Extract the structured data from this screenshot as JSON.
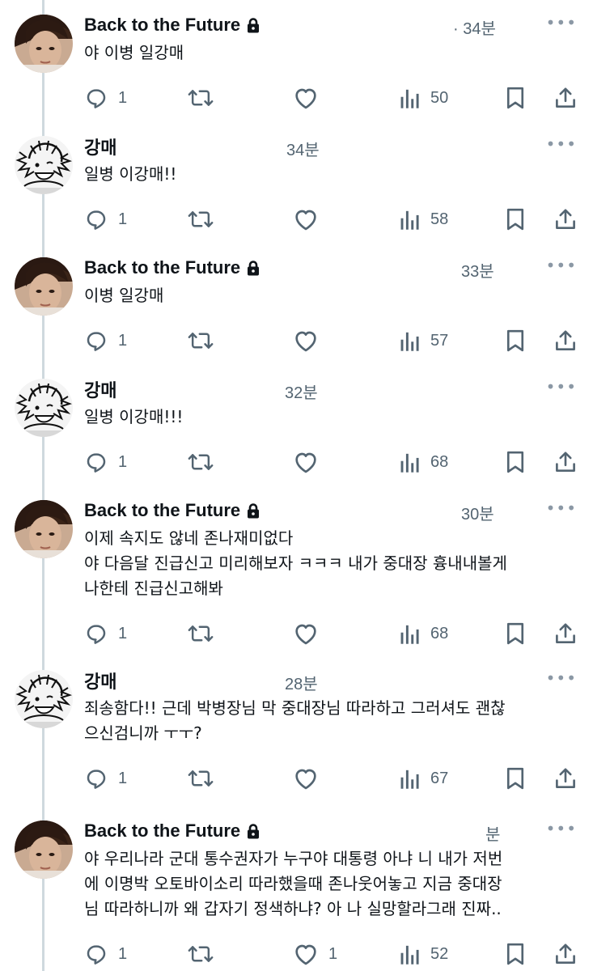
{
  "colors": {
    "text": "#0f1419",
    "muted": "#536471",
    "thread_line": "#cfd9de",
    "icon": "#536471"
  },
  "tweets": [
    {
      "author": "Back to the Future",
      "locked": true,
      "meta": "· 34분",
      "avatar": "portrait",
      "lines": [
        "야 이병 일강매"
      ],
      "replies": "1",
      "retweets": "",
      "likes": "",
      "views": "50"
    },
    {
      "author": "강매",
      "locked": false,
      "meta": "34분",
      "avatar": "cartoon",
      "lines": [
        "일병 이강매!!"
      ],
      "replies": "1",
      "retweets": "",
      "likes": "",
      "views": "58"
    },
    {
      "author": "Back to the Future",
      "locked": true,
      "meta": "33분",
      "avatar": "portrait",
      "lines": [
        "이병 일강매"
      ],
      "replies": "1",
      "retweets": "",
      "likes": "",
      "views": "57"
    },
    {
      "author": "강매",
      "locked": false,
      "meta": "32분",
      "avatar": "cartoon",
      "lines": [
        "일병 이강매!!!"
      ],
      "replies": "1",
      "retweets": "",
      "likes": "",
      "views": "68"
    },
    {
      "author": "Back to the Future",
      "locked": true,
      "meta": "30분",
      "avatar": "portrait",
      "lines": [
        "이제 속지도 않네 존나재미없다",
        "야 다음달 진급신고 미리해보자 ㅋㅋㅋ 내가 중대장 흉내내볼게",
        "나한테 진급신고해봐"
      ],
      "replies": "1",
      "retweets": "",
      "likes": "",
      "views": "68"
    },
    {
      "author": "강매",
      "locked": false,
      "meta": "28분",
      "avatar": "cartoon",
      "lines": [
        "죄송함다!! 근데 박병장님 막 중대장님 따라하고 그러셔도 괜찮",
        "으신검니까 ㅜㅜ?"
      ],
      "replies": "1",
      "retweets": "",
      "likes": "",
      "views": "67"
    },
    {
      "author": "Back to the Future",
      "locked": true,
      "meta": "분",
      "avatar": "portrait",
      "lines": [
        "야 우리나라 군대 통수권자가 누구야 대통령 아냐 니 내가 저번",
        "에 이명박 오토바이소리 따라했을때 존나웃어놓고 지금 중대장",
        "님 따라하니까 왜 갑자기 정색하냐? 아 나 실망할라그래 진짜.."
      ],
      "replies": "1",
      "retweets": "",
      "likes": "1",
      "views": "52"
    }
  ]
}
